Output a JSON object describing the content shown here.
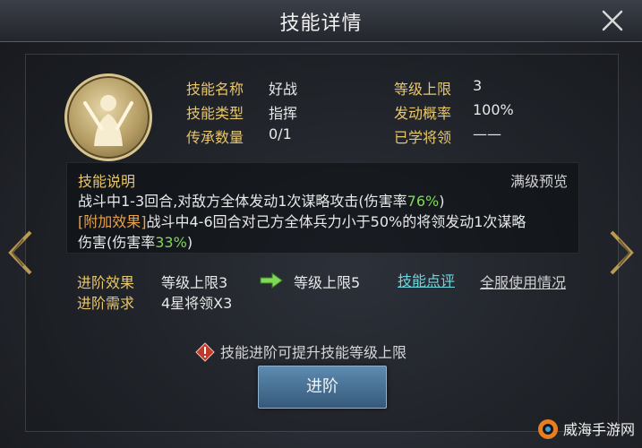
{
  "window": {
    "title": "技能详情"
  },
  "skill": {
    "name_label": "技能名称",
    "name": "好战",
    "type_label": "技能类型",
    "type": "指挥",
    "inherit_label": "传承数量",
    "inherit": "0/1",
    "level_cap_label": "等级上限",
    "level_cap": "3",
    "trigger_label": "发动概率",
    "trigger": "100%",
    "learned_label": "已学将领",
    "learned": "——"
  },
  "description": {
    "title": "技能说明",
    "preview_link": "满级预览",
    "line1_text": "战斗中1-3回合,对敌方全体发动1次谋略攻击(伤害率",
    "line1_value": "76%",
    "line1_close": ")",
    "line2_tag": "[附加效果]",
    "line2_text": "战斗中4-6回合对己方全体兵力小于50%的将领发动1次谋略",
    "line3_text": "伤害(伤害率",
    "line3_value": "33%",
    "line3_close": ")"
  },
  "advance": {
    "effect_label": "进阶效果",
    "effect_from": "等级上限3",
    "effect_to": "等级上限5",
    "req_label": "进阶需求",
    "req_value": "4星将领X3",
    "review_link": "技能点评",
    "usage_link": "全服使用情况"
  },
  "warning": "技能进阶可提升技能等级上限",
  "button": {
    "advance": "进阶"
  },
  "watermark": "威海手游网",
  "colors": {
    "accent_gold": "#e8c66b",
    "value_green": "#7ed957",
    "link_cyan": "#6fd6e0",
    "button_blue": "#4a7498"
  }
}
